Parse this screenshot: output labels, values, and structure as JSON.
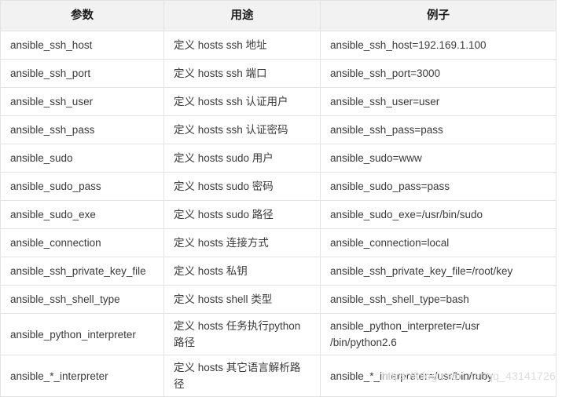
{
  "table": {
    "headers": [
      "参数",
      "用途",
      "例子"
    ],
    "rows": [
      {
        "param": "ansible_ssh_host",
        "usage": "定义 hosts ssh 地址",
        "example": "ansible_ssh_host=192.169.1.100",
        "tall": false
      },
      {
        "param": "ansible_ssh_port",
        "usage": "定义 hosts ssh 端口",
        "example": "ansible_ssh_port=3000",
        "tall": false
      },
      {
        "param": "ansible_ssh_user",
        "usage": "定义 hosts ssh 认证用户",
        "example": "ansible_ssh_user=user",
        "tall": false
      },
      {
        "param": "ansible_ssh_pass",
        "usage": "定义 hosts ssh 认证密码",
        "example": "ansible_ssh_pass=pass",
        "tall": false
      },
      {
        "param": "ansible_sudo",
        "usage": "定义 hosts sudo 用户",
        "example": "ansible_sudo=www",
        "tall": false
      },
      {
        "param": "ansible_sudo_pass",
        "usage": "定义 hosts sudo 密码",
        "example": "ansible_sudo_pass=pass",
        "tall": false
      },
      {
        "param": "ansible_sudo_exe",
        "usage": "定义 hosts sudo 路径",
        "example": "ansible_sudo_exe=/usr/bin/sudo",
        "tall": false
      },
      {
        "param": "ansible_connection",
        "usage": "定义 hosts 连接方式",
        "example": "ansible_connection=local",
        "tall": false
      },
      {
        "param": "ansible_ssh_private_key_file",
        "usage": "定义 hosts 私钥",
        "example": "ansible_ssh_private_key_file=/root/key",
        "tall": false
      },
      {
        "param": "ansible_ssh_shell_type",
        "usage": "定义 hosts shell 类型",
        "example": "ansible_ssh_shell_type=bash",
        "tall": false
      },
      {
        "param": "ansible_python_interpreter",
        "usage": "定义 hosts 任务执行python 路径",
        "example": "ansible_python_interpreter=/usr /bin/python2.6",
        "tall": true
      },
      {
        "param": "ansible_*_interpreter",
        "usage": "定义 hosts 其它语言解析路径",
        "example": "ansible_*_interpreter=/usr/bin/ruby",
        "tall": true
      }
    ]
  },
  "watermark": {
    "text": "https://blog.csdn.net/qq_43141726"
  },
  "colors": {
    "header_bg": "#f2f2f2",
    "border": "#e3e3e3",
    "text": "#3a3a3a",
    "watermark": "#dcdcdc"
  }
}
